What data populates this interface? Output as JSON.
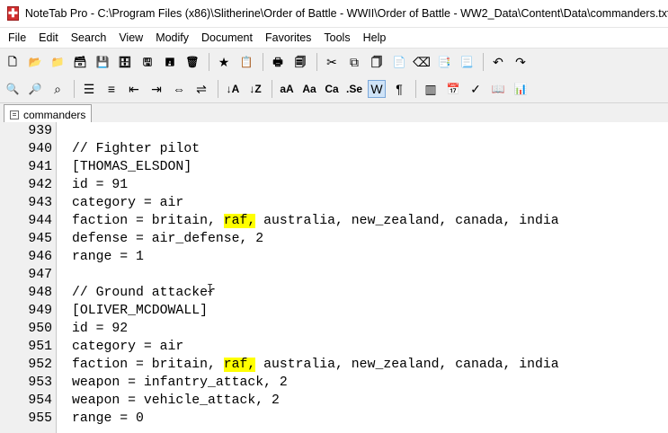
{
  "window": {
    "title": "NoteTab Pro  -  C:\\Program Files (x86)\\Slitherine\\Order of Battle - WWII\\Order of Battle - WW2_Data\\Content\\Data\\commanders.txt",
    "icon": "notetab-app-icon"
  },
  "menu": [
    "File",
    "Edit",
    "Search",
    "View",
    "Modify",
    "Document",
    "Favorites",
    "Tools",
    "Help"
  ],
  "tab": {
    "label": "commanders"
  },
  "editor": {
    "lines": [
      {
        "num": "939",
        "parts": [
          {
            "t": "",
            "hl": false
          }
        ]
      },
      {
        "num": "940",
        "parts": [
          {
            "t": "// Fighter pilot",
            "hl": false
          }
        ]
      },
      {
        "num": "941",
        "parts": [
          {
            "t": "[THOMAS_ELSDON]",
            "hl": false
          }
        ]
      },
      {
        "num": "942",
        "parts": [
          {
            "t": "id = 91",
            "hl": false
          }
        ]
      },
      {
        "num": "943",
        "parts": [
          {
            "t": "category = air",
            "hl": false
          }
        ]
      },
      {
        "num": "944",
        "parts": [
          {
            "t": "faction = britain, ",
            "hl": false
          },
          {
            "t": "raf,",
            "hl": true
          },
          {
            "t": " australia, new_zealand, canada, india",
            "hl": false
          }
        ]
      },
      {
        "num": "945",
        "parts": [
          {
            "t": "defense = air_defense, 2",
            "hl": false
          }
        ]
      },
      {
        "num": "946",
        "parts": [
          {
            "t": "range = 1",
            "hl": false
          }
        ]
      },
      {
        "num": "947",
        "parts": [
          {
            "t": "",
            "hl": false
          }
        ]
      },
      {
        "num": "948",
        "parts": [
          {
            "t": "// Ground attacker",
            "hl": false
          }
        ]
      },
      {
        "num": "949",
        "parts": [
          {
            "t": "[OLIVER_MCDOWALL]",
            "hl": false
          }
        ]
      },
      {
        "num": "950",
        "parts": [
          {
            "t": "id = 92",
            "hl": false
          }
        ]
      },
      {
        "num": "951",
        "parts": [
          {
            "t": "category = air",
            "hl": false
          }
        ]
      },
      {
        "num": "952",
        "parts": [
          {
            "t": "faction = britain, ",
            "hl": false
          },
          {
            "t": "raf,",
            "hl": true
          },
          {
            "t": " australia, new_zealand, canada, india",
            "hl": false
          }
        ]
      },
      {
        "num": "953",
        "parts": [
          {
            "t": "weapon = infantry_attack, 2",
            "hl": false
          }
        ]
      },
      {
        "num": "954",
        "parts": [
          {
            "t": "weapon = vehicle_attack, 2",
            "hl": false
          }
        ]
      },
      {
        "num": "955",
        "parts": [
          {
            "t": "range = 0",
            "hl": false
          }
        ]
      }
    ]
  },
  "toolbar1": [
    {
      "name": "new-file-icon",
      "glyph": "🗋"
    },
    {
      "name": "open-file-icon",
      "glyph": "📂"
    },
    {
      "name": "open-folder-icon",
      "glyph": "📁"
    },
    {
      "name": "open-multiple-icon",
      "glyph": "🗃"
    },
    {
      "name": "save-icon",
      "glyph": "💾"
    },
    {
      "name": "save-all-icon",
      "glyph": "🗄"
    },
    {
      "name": "save-as-icon",
      "glyph": "🖫"
    },
    {
      "name": "save-close-icon",
      "glyph": "🖪"
    },
    {
      "name": "delete-icon",
      "glyph": "🗑"
    },
    {
      "sep": true
    },
    {
      "name": "favorites-icon",
      "glyph": "★"
    },
    {
      "name": "clipbook-icon",
      "glyph": "📋"
    },
    {
      "sep": true
    },
    {
      "name": "print-icon",
      "glyph": "🖶"
    },
    {
      "name": "print-preview-icon",
      "glyph": "🗐"
    },
    {
      "sep": true
    },
    {
      "name": "cut-icon",
      "glyph": "✂"
    },
    {
      "name": "copy-icon",
      "glyph": "⧉"
    },
    {
      "name": "copy-append-icon",
      "glyph": "🗍"
    },
    {
      "name": "paste-icon",
      "glyph": "📄"
    },
    {
      "name": "erase-icon",
      "glyph": "⌫"
    },
    {
      "name": "paste-special-icon",
      "glyph": "📑"
    },
    {
      "name": "paste-clear-icon",
      "glyph": "📃"
    },
    {
      "sep": true
    },
    {
      "name": "undo-icon",
      "glyph": "↶"
    },
    {
      "name": "redo-icon",
      "glyph": "↷"
    }
  ],
  "toolbar2": [
    {
      "name": "find-icon",
      "glyph": "🔍"
    },
    {
      "name": "find-replace-icon",
      "glyph": "🔎"
    },
    {
      "name": "find-next-icon",
      "glyph": "⌕"
    },
    {
      "sep": true
    },
    {
      "name": "bullet-list-icon",
      "glyph": "☰"
    },
    {
      "name": "numbered-list-icon",
      "glyph": "≡"
    },
    {
      "name": "outdent-icon",
      "glyph": "⇤"
    },
    {
      "name": "indent-icon",
      "glyph": "⇥"
    },
    {
      "name": "justify-icon",
      "glyph": "⇔"
    },
    {
      "name": "align-icon",
      "glyph": "⇌"
    },
    {
      "sep": true
    },
    {
      "name": "sort-ascending-icon",
      "glyph": "↓A"
    },
    {
      "name": "sort-descending-icon",
      "glyph": "↓Z"
    },
    {
      "sep": true
    },
    {
      "name": "lowercase-icon",
      "glyph": "aA"
    },
    {
      "name": "uppercase-icon",
      "glyph": "Aa"
    },
    {
      "name": "capitalize-icon",
      "glyph": "Ca"
    },
    {
      "name": "sentence-case-icon",
      "glyph": ".Se"
    },
    {
      "name": "word-wrap-icon",
      "glyph": "W",
      "active": true
    },
    {
      "name": "paragraph-marks-icon",
      "glyph": "¶"
    },
    {
      "sep": true
    },
    {
      "name": "column-view-icon",
      "glyph": "▥"
    },
    {
      "name": "calendar-icon",
      "glyph": "📅"
    },
    {
      "name": "spellcheck-icon",
      "glyph": "✓"
    },
    {
      "name": "dictionary-icon",
      "glyph": "📖"
    },
    {
      "name": "statistics-icon",
      "glyph": "📊"
    }
  ]
}
